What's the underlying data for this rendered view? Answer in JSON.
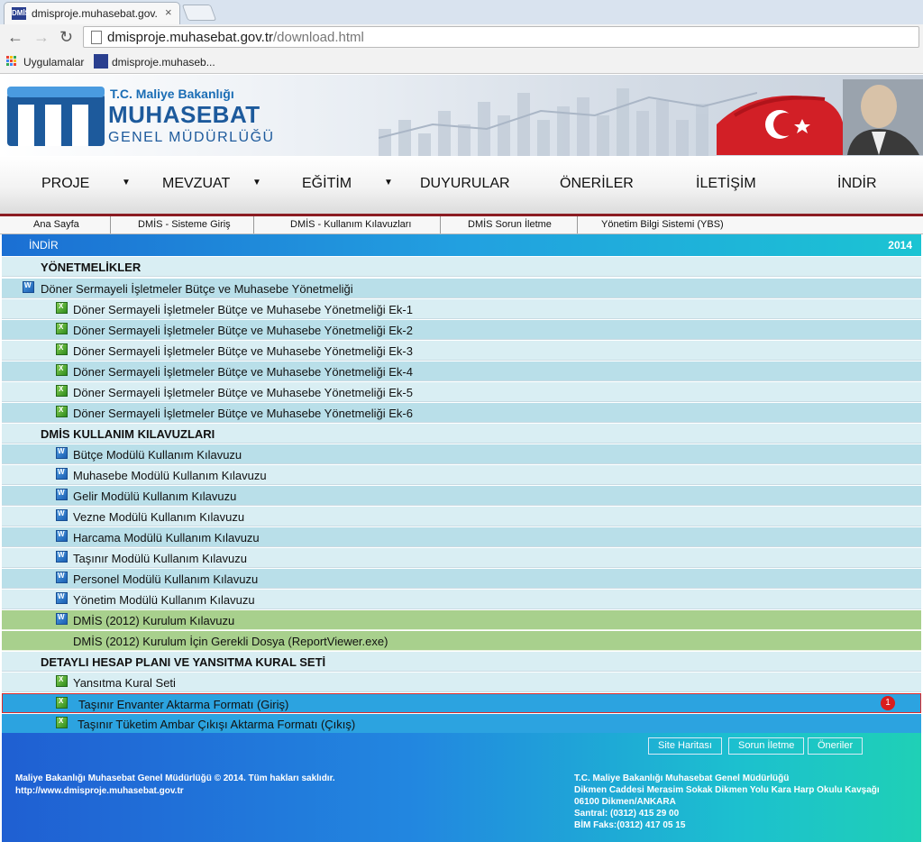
{
  "browser": {
    "tab_title": "dmisproje.muhasebat.gov.",
    "tab_close": "×",
    "favicon_text": "DMİS",
    "url_host": "dmisproje.muhasebat.gov.tr",
    "url_path": "/download.html",
    "bookmarks": [
      "Uygulamalar",
      "dmisproje.muhaseb..."
    ]
  },
  "header": {
    "logo_sub": "T.C. Maliye Bakanlığı",
    "logo_main": "MUHASEBAT",
    "logo_sub2": "GENEL MÜDÜRLÜĞÜ"
  },
  "main_nav": [
    "PROJE",
    "MEVZUAT",
    "EĞİTİM",
    "DUYURULAR",
    "ÖNERİLER",
    "İLETİŞİM",
    "İNDİR"
  ],
  "sub_nav": [
    "Ana Sayfa",
    "DMİS - Sisteme Giriş",
    "DMİS - Kullanım Kılavuzları",
    "DMİS Sorun İletme",
    "Yönetim Bilgi Sistemi (YBS)"
  ],
  "content": {
    "title": "İNDİR",
    "year": "2014",
    "rows": [
      {
        "text": "YÖNETMELİKLER"
      },
      {
        "text": "Döner Sermayeli İşletmeler Bütçe ve Muhasebe Yönetmeliği",
        "icon": "word-document-icon"
      },
      {
        "text": "Döner Sermayeli İşletmeler Bütçe ve Muhasebe Yönetmeliği Ek-1",
        "icon": "excel-document-icon"
      },
      {
        "text": "Döner Sermayeli İşletmeler Bütçe ve Muhasebe Yönetmeliği Ek-2",
        "icon": "excel-document-icon"
      },
      {
        "text": "Döner Sermayeli İşletmeler Bütçe ve Muhasebe Yönetmeliği Ek-3",
        "icon": "excel-document-icon"
      },
      {
        "text": "Döner Sermayeli İşletmeler Bütçe ve Muhasebe Yönetmeliği Ek-4",
        "icon": "excel-document-icon"
      },
      {
        "text": "Döner Sermayeli İşletmeler Bütçe ve Muhasebe Yönetmeliği Ek-5",
        "icon": "excel-document-icon"
      },
      {
        "text": "Döner Sermayeli İşletmeler Bütçe ve Muhasebe Yönetmeliği Ek-6",
        "icon": "excel-document-icon"
      },
      {
        "text": "DMİS KULLANIM KILAVUZLARI"
      },
      {
        "text": "Bütçe Modülü Kullanım Kılavuzu",
        "icon": "word-document-icon"
      },
      {
        "text": "Muhasebe Modülü Kullanım Kılavuzu",
        "icon": "word-document-icon"
      },
      {
        "text": "Gelir Modülü Kullanım Kılavuzu",
        "icon": "word-document-icon"
      },
      {
        "text": "Vezne Modülü Kullanım Kılavuzu",
        "icon": "word-document-icon"
      },
      {
        "text": "Harcama Modülü Kullanım Kılavuzu",
        "icon": "word-document-icon"
      },
      {
        "text": "Taşınır Modülü Kullanım Kılavuzu",
        "icon": "word-document-icon"
      },
      {
        "text": "Personel Modülü Kullanım Kılavuzu",
        "icon": "word-document-icon"
      },
      {
        "text": "Yönetim Modülü Kullanım Kılavuzu",
        "icon": "word-document-icon"
      },
      {
        "text": "DMİS (2012) Kurulum Kılavuzu",
        "icon": "word-document-icon"
      },
      {
        "text": "DMİS (2012) Kurulum İçin Gerekli Dosya (ReportViewer.exe)"
      },
      {
        "text": "DETAYLI HESAP PLANI VE YANSITMA KURAL SETİ"
      },
      {
        "text": "Yansıtma Kural Seti",
        "icon": "excel-document-icon"
      },
      {
        "text": "Taşınır Envanter Aktarma Formatı (Giriş)",
        "icon": "excel-document-icon",
        "badge": "1"
      },
      {
        "text": "Taşınır Tüketim Ambar Çıkışı Aktarma Formatı (Çıkış)",
        "icon": "excel-document-icon"
      }
    ]
  },
  "footer": {
    "buttons": [
      "Site Haritası",
      "Sorun İletme",
      "Öneriler"
    ],
    "left_lines": [
      "Maliye Bakanlığı Muhasebat Genel Müdürlüğü © 2014. Tüm hakları saklıdır.",
      "http://www.dmisproje.muhasebat.gov.tr"
    ],
    "right_lines": [
      "T.C. Maliye Bakanlığı Muhasebat Genel Müdürlüğü",
      "Dikmen Caddesi Merasim Sokak Dikmen Yolu Kara Harp Okulu Kavşağı",
      "06100 Dikmen/ANKARA",
      "Santral:   (0312) 415 29 00",
      "BİM Faks:(0312) 417 05 15"
    ]
  },
  "colors": {
    "header_gradient": [
      "#1b6fd3",
      "#1bc4d3"
    ],
    "nav_border": "#8b1c22",
    "row_light": "#d9eef3",
    "row_dark": "#b9dfe9",
    "row_green": "#a8d08d",
    "row_selected": "#2ca3e0",
    "badge": "#d91d1d"
  }
}
